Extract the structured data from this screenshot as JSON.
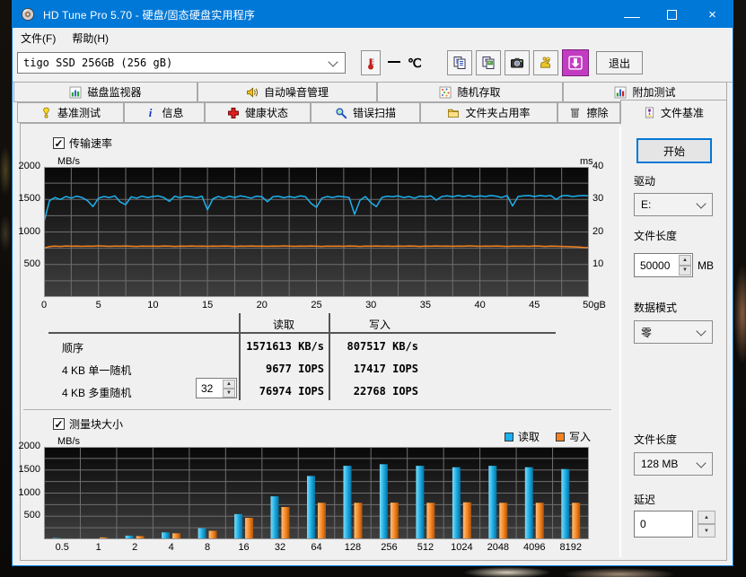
{
  "window": {
    "title": "HD Tune Pro 5.70 - 硬盘/固态硬盘实用程序"
  },
  "menu": {
    "items": [
      {
        "label": "文件(F)"
      },
      {
        "label": "帮助(H)"
      }
    ]
  },
  "toolbar": {
    "drive_select_value": "tigo SSD 256GB (256 gB)",
    "temp_unit": "℃",
    "exit_label": "退出"
  },
  "tabs": {
    "row1": [
      {
        "label": "磁盘监视器"
      },
      {
        "label": "自动噪音管理"
      },
      {
        "label": "随机存取"
      },
      {
        "label": "附加测试"
      }
    ],
    "row2": [
      {
        "label": "基准测试"
      },
      {
        "label": "信息"
      },
      {
        "label": "健康状态"
      },
      {
        "label": "错误扫描"
      },
      {
        "label": "文件夹占用率"
      },
      {
        "label": "擦除"
      },
      {
        "label": "文件基准"
      }
    ]
  },
  "sections": {
    "transfer_rate_label": "传输速率",
    "block_size_label": "测量块大小"
  },
  "table": {
    "read_header": "读取",
    "write_header": "写入",
    "rows": [
      {
        "label": "顺序",
        "read": "1571613 KB/s",
        "write": "807517 KB/s"
      },
      {
        "label": "4 KB 单一随机",
        "read": "9677 IOPS",
        "write": "17417 IOPS"
      },
      {
        "label": "4 KB 多重随机",
        "queue": "32",
        "read": "76974 IOPS",
        "write": "22768 IOPS"
      }
    ]
  },
  "side_panel": {
    "start_label": "开始",
    "drive_label": "驱动",
    "drive_value": "E:",
    "file_length_label": "文件长度",
    "file_length_value": "50000",
    "file_length_unit": "MB",
    "data_mode_label": "数据模式",
    "data_mode_value": "零",
    "file_length2_label": "文件长度",
    "file_length2_value": "128 MB",
    "delay_label": "延迟",
    "delay_value": "0"
  },
  "chart_data": [
    {
      "type": "line",
      "title": "传输速率",
      "ylabel": "MB/s",
      "y2label": "ms",
      "xlim": [
        0,
        50
      ],
      "ylim": [
        0,
        2000
      ],
      "y2lim": [
        0,
        40
      ],
      "xticks": [
        0,
        5,
        10,
        15,
        20,
        25,
        30,
        35,
        40,
        45
      ],
      "xtick_last": "50gB",
      "yticks": [
        2000,
        1500,
        1000,
        500
      ],
      "y2ticks": [
        40,
        30,
        20,
        10
      ],
      "grid_x_step": 2.5,
      "grid_y_step": 250,
      "legend_position": "none",
      "grid": true,
      "series": [
        {
          "name": "读取",
          "color": "#1cb0ee",
          "x_step": 0.5,
          "values": [
            1150,
            1480,
            1530,
            1500,
            1545,
            1520,
            1550,
            1530,
            1480,
            1390,
            1520,
            1545,
            1530,
            1555,
            1460,
            1420,
            1540,
            1520,
            1550,
            1530,
            1545,
            1555,
            1530,
            1470,
            1550,
            1525,
            1550,
            1540,
            1525,
            1550,
            1340,
            1510,
            1545,
            1520,
            1550,
            1530,
            1555,
            1540,
            1520,
            1550,
            1540,
            1465,
            1540,
            1550,
            1525,
            1545,
            1530,
            1555,
            1540,
            1440,
            1380,
            1520,
            1545,
            1530,
            1550,
            1540,
            1530,
            1270,
            1490,
            1545,
            1450,
            1390,
            1530,
            1550,
            1540,
            1555,
            1530,
            1545,
            1520,
            1550,
            1540,
            1555,
            1490,
            1545,
            1555,
            1540,
            1560,
            1545,
            1560,
            1540,
            1555,
            1545,
            1560,
            1550,
            1530,
            1560,
            1400,
            1545,
            1555,
            1560,
            1545,
            1560,
            1550,
            1560,
            1500,
            1555,
            1560,
            1545,
            1555,
            1560,
            1555
          ]
        },
        {
          "name": "写入",
          "color": "#f5821f",
          "x_step": 0.5,
          "values": [
            752,
            775,
            782,
            778,
            785,
            780,
            783,
            779,
            784,
            781,
            786,
            782,
            779,
            784,
            780,
            785,
            781,
            778,
            783,
            780,
            784,
            779,
            785,
            782,
            778,
            783,
            780,
            785,
            781,
            784,
            779,
            783,
            780,
            785,
            782,
            778,
            784,
            781,
            785,
            780,
            783,
            779,
            784,
            781,
            786,
            782,
            779,
            784,
            780,
            785,
            781,
            778,
            783,
            780,
            784,
            779,
            785,
            782,
            778,
            783,
            780,
            785,
            781,
            784,
            779,
            783,
            780,
            785,
            782,
            778,
            784,
            781,
            785,
            780,
            783,
            779,
            784,
            781,
            786,
            782,
            779,
            784,
            780,
            785,
            781,
            778,
            783,
            780,
            784,
            779,
            785,
            782,
            778,
            783,
            780,
            778,
            775,
            772,
            768,
            762,
            758
          ]
        }
      ]
    },
    {
      "type": "bar",
      "title": "测量块大小",
      "ylabel": "MB/s",
      "ylim": [
        0,
        2000
      ],
      "yticks": [
        2000,
        1500,
        1000,
        500
      ],
      "grid_y_step": 250,
      "grid": true,
      "legend_position": "top-right",
      "categories": [
        "0.5",
        "1",
        "2",
        "4",
        "8",
        "16",
        "32",
        "64",
        "128",
        "256",
        "512",
        "1024",
        "2048",
        "4096",
        "8192"
      ],
      "series": [
        {
          "name": "读取",
          "color": "#1cb0ee",
          "values": [
            30,
            15,
            80,
            150,
            240,
            545,
            930,
            1370,
            1590,
            1625,
            1590,
            1560,
            1590,
            1560,
            1520
          ]
        },
        {
          "name": "写入",
          "color": "#f5821f",
          "values": [
            8,
            40,
            70,
            130,
            185,
            465,
            700,
            790,
            790,
            795,
            790,
            800,
            790,
            790,
            790
          ]
        }
      ]
    }
  ]
}
